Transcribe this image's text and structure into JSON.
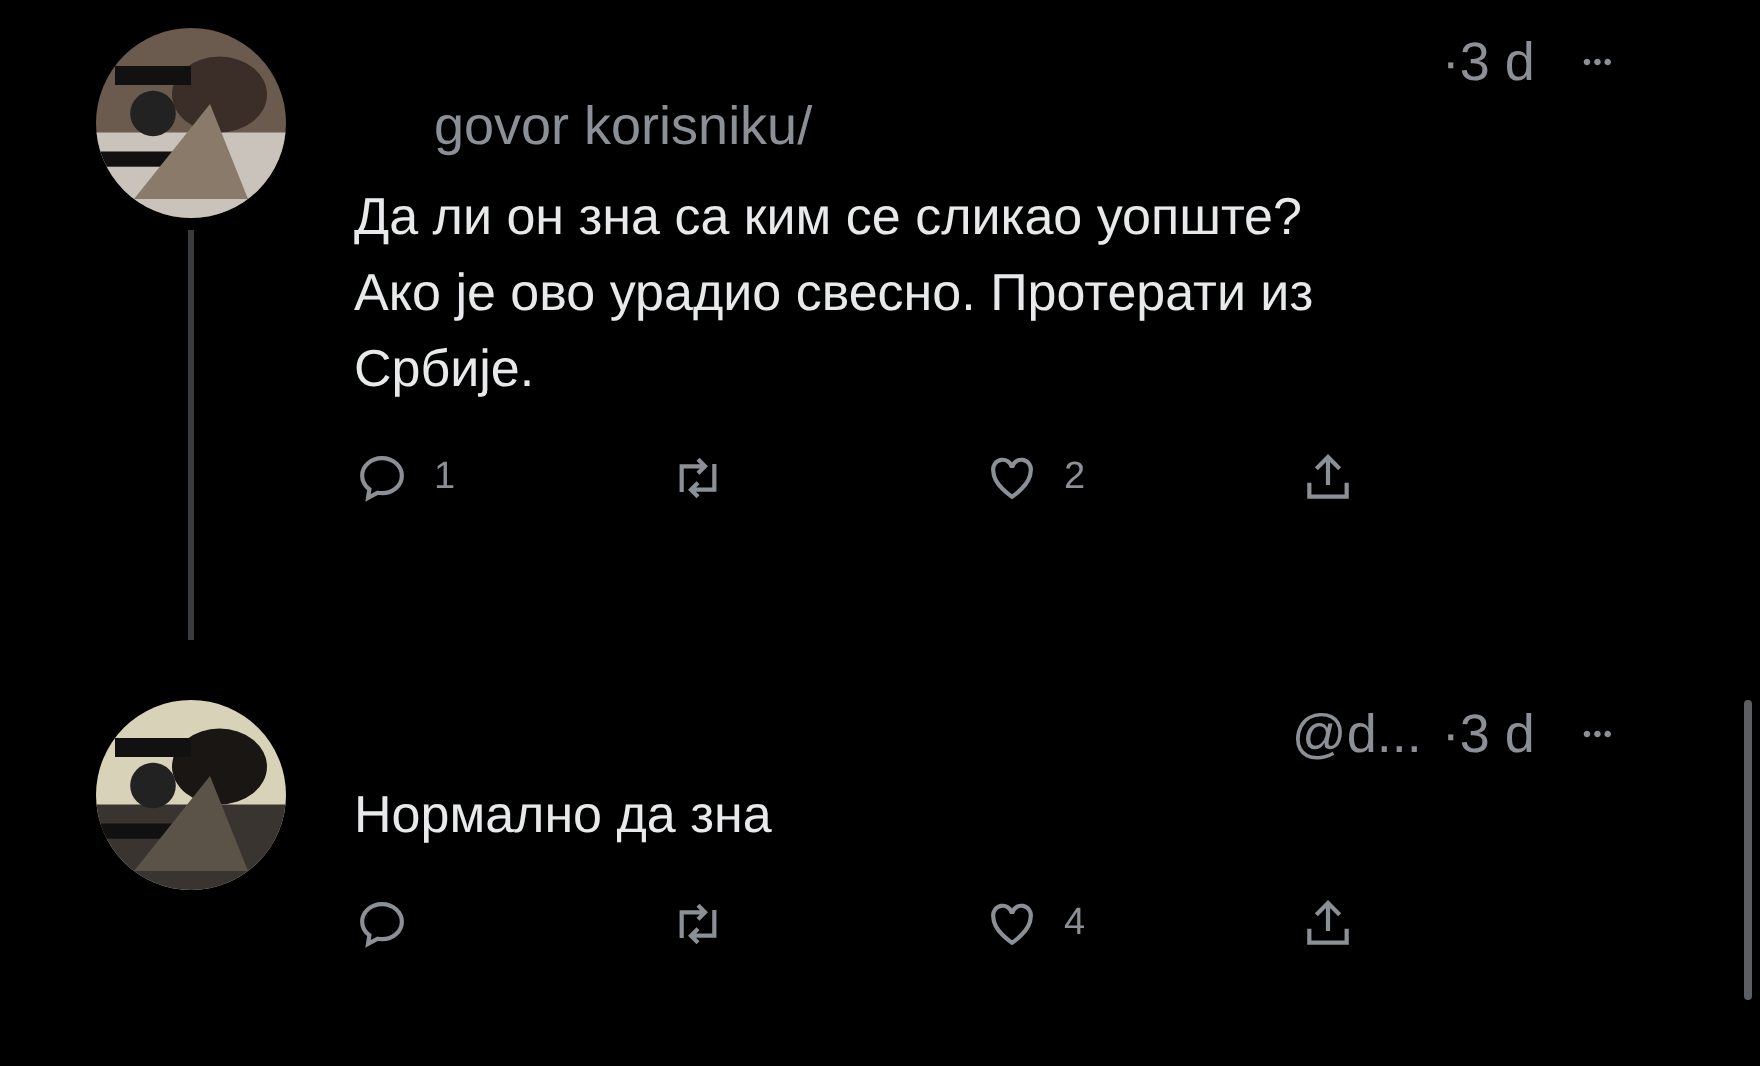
{
  "tweets": [
    {
      "time": "·3 d",
      "more": "•••",
      "reply_to": "govor korisniku/",
      "text": "Да ли он зна са ким се сликао уопште? Ако је ово урадио свесно. Протерати из Србије.",
      "thread_line": true,
      "actions": {
        "replies": "1",
        "likes": "2"
      }
    },
    {
      "handle": "@d...",
      "time": "·3 d",
      "more": "•••",
      "text": "Нормално да зна",
      "thread_line": false,
      "actions": {
        "likes": "4"
      }
    }
  ]
}
